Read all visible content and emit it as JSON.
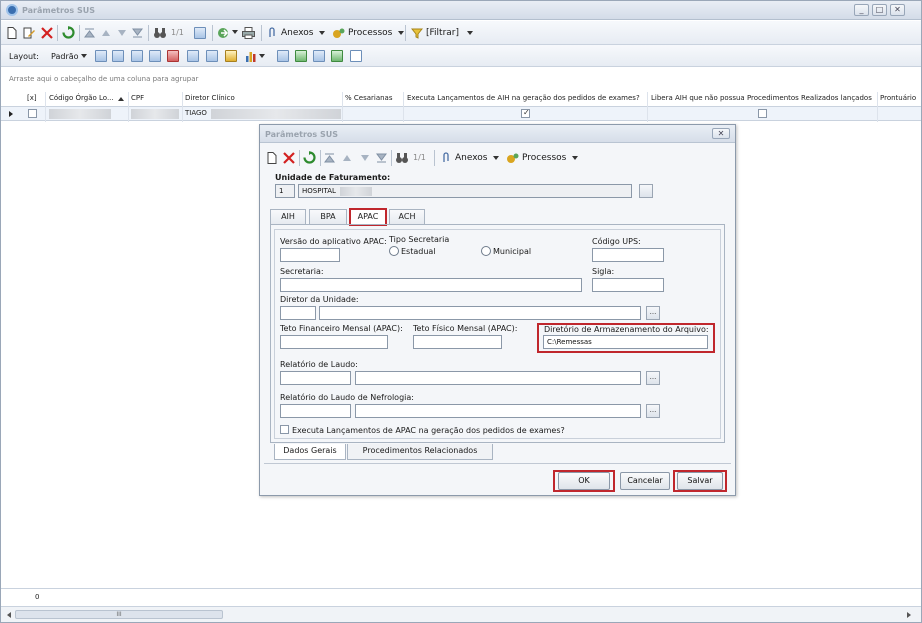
{
  "window": {
    "title": "Parâmetros SUS",
    "controls": [
      "_",
      "□",
      "✕"
    ]
  },
  "toolbar": {
    "page_info": "1/1",
    "anexos": "Anexos",
    "processos": "Processos",
    "filtrar": "[Filtrar]"
  },
  "layout_bar": {
    "layout_label": "Layout:",
    "padrao": "Padrão"
  },
  "grid": {
    "group_hint": "Arraste aqui o cabeçalho de uma coluna para agrupar",
    "columns": [
      "[x]",
      "Código Órgão Lo...",
      "CPF",
      "Diretor Clínico",
      "% Cesarianas",
      "Executa Lançamentos de AIH na geração dos pedidos de exames?",
      "Libera AIH que não possua Procedimentos Realizados lançados",
      "Prontuário"
    ],
    "row": {
      "diretor": "TIAGO",
      "executa_aih": true,
      "libera_aih": false
    },
    "footer_count": "0",
    "scroll_grip": "III"
  },
  "dialog": {
    "title": "Parâmetros SUS",
    "close": "✕",
    "toolbar": {
      "page_info": "1/1",
      "anexos": "Anexos",
      "processos": "Processos"
    },
    "unidade_label": "Unidade de Faturamento:",
    "unidade_code": "1",
    "unidade_name": "HOSPITAL",
    "tabs": [
      "AIH",
      "BPA",
      "APAC",
      "ACH"
    ],
    "active_tab": "APAC",
    "fields": {
      "versao_label": "Versão do aplicativo APAC:",
      "tipo_secretaria_label": "Tipo Secretaria",
      "estadual": "Estadual",
      "municipal": "Municipal",
      "codigo_ups_label": "Código UPS:",
      "secretaria_label": "Secretaria:",
      "sigla_label": "Sigla:",
      "diretor_label": "Diretor da Unidade:",
      "teto_fin_label": "Teto Financeiro Mensal (APAC):",
      "teto_fis_label": "Teto Físico Mensal (APAC):",
      "diretorio_label": "Diretório de Armazenamento do Arquivo:",
      "diretorio_value": "C:\\Remessas",
      "relatorio_laudo_label": "Relatório de Laudo:",
      "relatorio_nefro_label": "Relatório do Laudo de Nefrologia:",
      "executa_apac_label": "Executa Lançamentos de APAC na geração dos pedidos de exames?",
      "ellipsis": "..."
    },
    "subtabs": [
      "Dados Gerais",
      "Procedimentos Relacionados"
    ],
    "buttons": {
      "ok": "OK",
      "cancelar": "Cancelar",
      "salvar": "Salvar"
    }
  }
}
